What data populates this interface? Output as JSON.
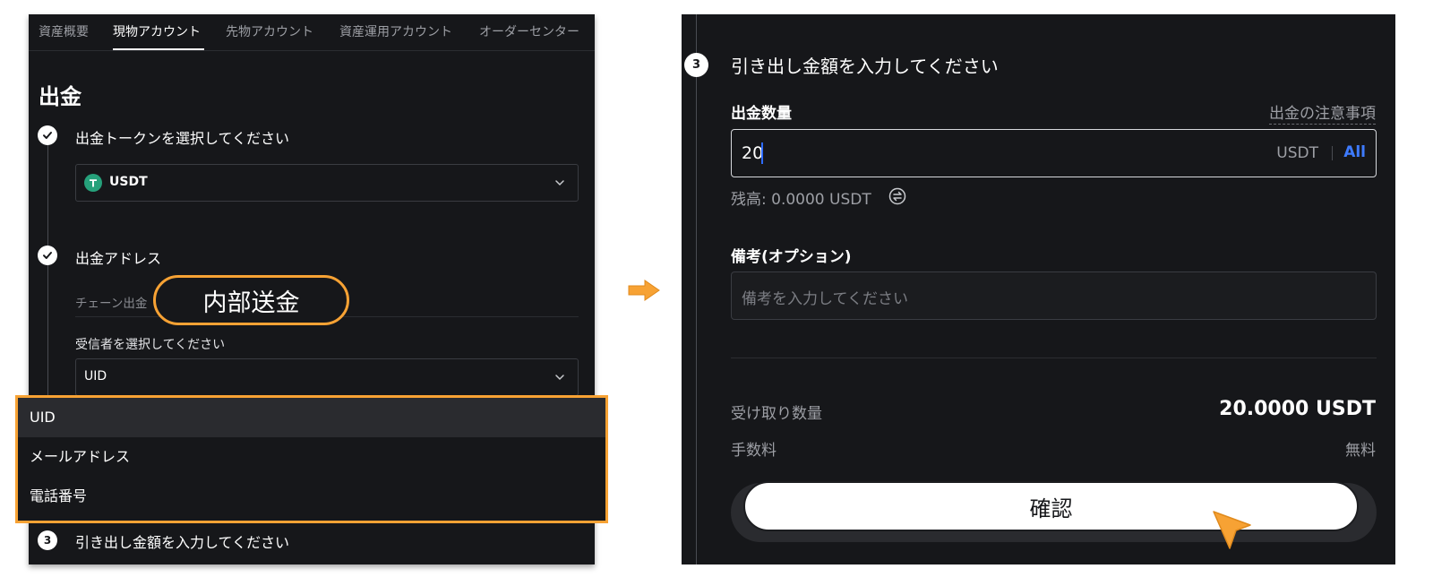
{
  "left": {
    "tabs": [
      "資産概要",
      "現物アカウント",
      "先物アカウント",
      "資産運用アカウント",
      "オーダーセンター"
    ],
    "title": "出金",
    "step1_label": "出金トークンを選択してください",
    "token": "USDT",
    "step2_label": "出金アドレス",
    "chain_tab": "チェーン出金",
    "callout": "内部送金",
    "recipient_label": "受信者を選択してください",
    "recipient_selected": "UID",
    "dropdown_options": [
      "UID",
      "メールアドレス",
      "電話番号"
    ],
    "step3_number": "3",
    "step3_label": "引き出し金額を入力してください"
  },
  "right": {
    "step_number": "3",
    "step_title": "引き出し金額を入力してください",
    "qty_label": "出金数量",
    "notice_link": "出金の注意事項",
    "amount_value": "20",
    "unit": "USDT",
    "all_label": "All",
    "balance": "残高: 0.0000 USDT",
    "memo_label": "備考(オプション)",
    "memo_placeholder": "備考を入力してください",
    "receive_label": "受け取り数量",
    "receive_value": "20.0000 USDT",
    "fee_label": "手数料",
    "fee_value": "無料",
    "confirm_label": "確認"
  },
  "colors": {
    "panel_bg": "#16171a",
    "highlight": "#f7a234",
    "accent_blue": "#3e7bff",
    "tether_green": "#26a17b"
  },
  "icons": [
    "check-icon",
    "tether-icon",
    "chevron-down-icon",
    "swap-icon",
    "arrow-right-icon",
    "pointer-cursor-icon"
  ]
}
